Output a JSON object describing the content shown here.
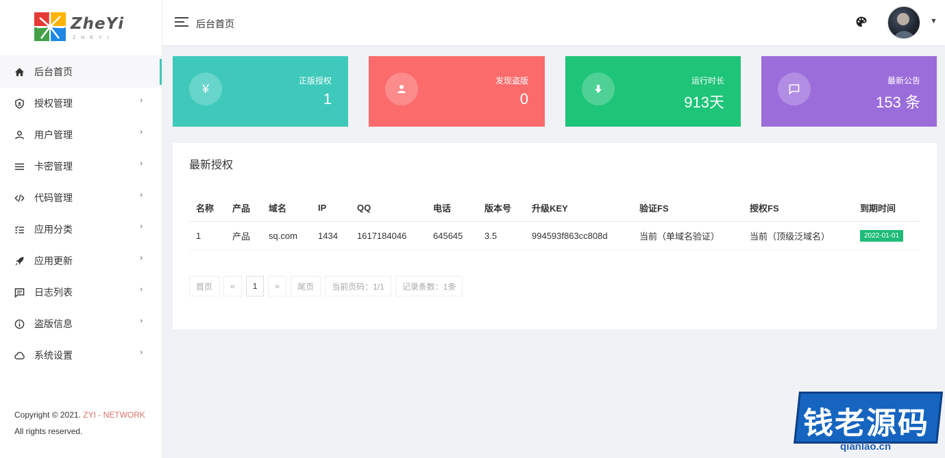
{
  "brand": {
    "logo_text": "ZheYi",
    "logo_sub": "ZHEYI"
  },
  "header": {
    "page_title": "后台首页"
  },
  "sidebar": {
    "items": [
      {
        "label": "后台首页",
        "icon": "home-icon",
        "active": true,
        "has_arrow": false
      },
      {
        "label": "授权管理",
        "icon": "shield-icon",
        "active": false,
        "has_arrow": true
      },
      {
        "label": "用户管理",
        "icon": "user-icon",
        "active": false,
        "has_arrow": true
      },
      {
        "label": "卡密管理",
        "icon": "list-icon",
        "active": false,
        "has_arrow": true
      },
      {
        "label": "代码管理",
        "icon": "code-icon",
        "active": false,
        "has_arrow": true
      },
      {
        "label": "应用分类",
        "icon": "checklist-icon",
        "active": false,
        "has_arrow": true
      },
      {
        "label": "应用更新",
        "icon": "rocket-icon",
        "active": false,
        "has_arrow": true
      },
      {
        "label": "日志列表",
        "icon": "message-icon",
        "active": false,
        "has_arrow": true
      },
      {
        "label": "盗版信息",
        "icon": "info-icon",
        "active": false,
        "has_arrow": true
      },
      {
        "label": "系统设置",
        "icon": "cloud-icon",
        "active": false,
        "has_arrow": true
      }
    ],
    "arrow": "›"
  },
  "footer": {
    "copyright_prefix": "Copyright © 2021.",
    "brand_link": "ZYI - NETWORK",
    "suffix": "All rights reserved."
  },
  "stats": [
    {
      "label": "正版授权",
      "value": "1",
      "icon": "yen-icon",
      "color": "#3ec9bb"
    },
    {
      "label": "发现盗版",
      "value": "0",
      "icon": "user-icon",
      "color": "#fb6b6b"
    },
    {
      "label": "运行时长",
      "value": "913天",
      "icon": "download-icon",
      "color": "#1ec478"
    },
    {
      "label": "最新公告",
      "value": "153 条",
      "icon": "message-icon",
      "color": "#9b6ddb"
    }
  ],
  "panel": {
    "title": "最新授权",
    "columns": [
      "名称",
      "产品",
      "域名",
      "IP",
      "QQ",
      "电话",
      "版本号",
      "升级KEY",
      "验证FS",
      "授权FS",
      "到期时间"
    ],
    "rows": [
      [
        "1",
        "产品",
        "sq.com",
        "1434",
        "1617184046",
        "645645",
        "3.5",
        "994593f863cc808d",
        "当前（单域名验证）",
        "当前（顶级泛域名）",
        "2022-01-01"
      ]
    ]
  },
  "pager": {
    "first": "首页",
    "prev": "«",
    "current": "1",
    "next": "»",
    "last": "尾页",
    "page_info": "当前页码：1/1",
    "record_info": "记录条数：1条"
  },
  "watermark": {
    "text": "钱老源码",
    "url": "qianlao.cn"
  }
}
